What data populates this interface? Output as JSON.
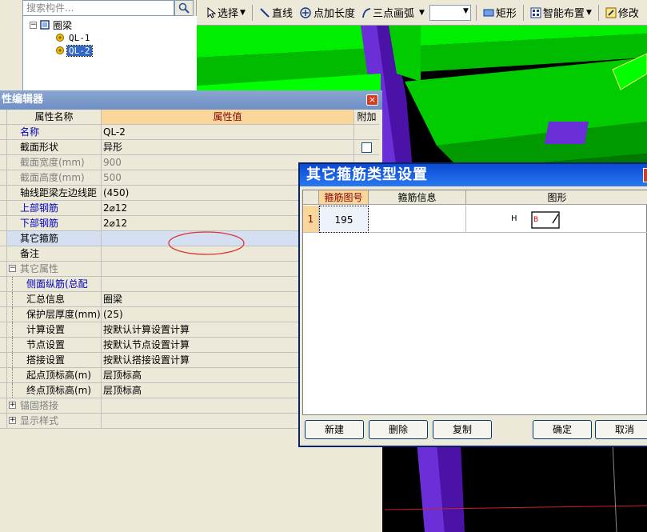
{
  "tree": {
    "search_placeholder": "搜索构件...",
    "root_label": "圈梁",
    "root_expander": "−",
    "items": [
      {
        "label": "QL-1",
        "selected": false
      },
      {
        "label": "QL-2",
        "selected": true
      }
    ]
  },
  "toolbar": {
    "select": "选择",
    "line": "直线",
    "point_length": "点加长度",
    "arc": "三点画弧",
    "rect": "矩形",
    "smart": "智能布置",
    "modify": "修改"
  },
  "prop_editor": {
    "title": "性编辑器",
    "close": "×",
    "headers": {
      "name": "属性名称",
      "value": "属性值",
      "extra": "附加"
    },
    "rows": [
      {
        "name": "名称",
        "value": "QL-2",
        "style": "blue",
        "check": false
      },
      {
        "name": "截面形状",
        "value": "异形",
        "style": "",
        "check": true
      },
      {
        "name": "截面宽度(mm)",
        "value": "900",
        "style": "gray",
        "check": false
      },
      {
        "name": "截面高度(mm)",
        "value": "500",
        "style": "gray",
        "check": false
      },
      {
        "name": "轴线距梁左边线距",
        "value": "(450)",
        "style": "",
        "check": false
      },
      {
        "name": "上部钢筋",
        "value": "2⌀12",
        "style": "blue",
        "check": false
      },
      {
        "name": "下部钢筋",
        "value": "2⌀12",
        "style": "blue",
        "check": false
      },
      {
        "name": "其它箍筋",
        "value": "",
        "style": "sel",
        "check": false
      },
      {
        "name": "备注",
        "value": "",
        "style": "",
        "check": false
      },
      {
        "name": "其它属性",
        "value": "",
        "style": "group",
        "check": false
      },
      {
        "name": "侧面纵筋(总配",
        "value": "",
        "style": "sub blue",
        "check": false
      },
      {
        "name": "汇总信息",
        "value": "圈梁",
        "style": "sub",
        "check": false
      },
      {
        "name": "保护层厚度(mm)",
        "value": "(25)",
        "style": "sub",
        "check": false
      },
      {
        "name": "计算设置",
        "value": "按默认计算设置计算",
        "style": "sub",
        "check": false
      },
      {
        "name": "节点设置",
        "value": "按默认节点设置计算",
        "style": "sub",
        "check": false
      },
      {
        "name": "搭接设置",
        "value": "按默认搭接设置计算",
        "style": "sub",
        "check": false
      },
      {
        "name": "起点顶标高(m)",
        "value": "层顶标高",
        "style": "sub",
        "check": false
      },
      {
        "name": "终点顶标高(m)",
        "value": "层顶标高",
        "style": "sub",
        "check": false
      },
      {
        "name": "锚固搭接",
        "value": "",
        "style": "group2",
        "check": false
      },
      {
        "name": "显示样式",
        "value": "",
        "style": "group2",
        "check": false
      }
    ]
  },
  "dialog": {
    "title": "其它箍筋类型设置",
    "headers": {
      "code": "箍筋图号",
      "info": "箍筋信息",
      "shape": "图形"
    },
    "row": {
      "index": "1",
      "code": "195",
      "info": "",
      "h_label": "H",
      "b_label": "B"
    },
    "buttons": {
      "new": "新建",
      "delete": "删除",
      "copy": "复制",
      "ok": "确定",
      "cancel": "取消"
    }
  },
  "colors": {
    "green": "#00ff00",
    "dark_green": "#009900",
    "purple": "#6600cc",
    "title_blue": "#0a4bd4"
  }
}
